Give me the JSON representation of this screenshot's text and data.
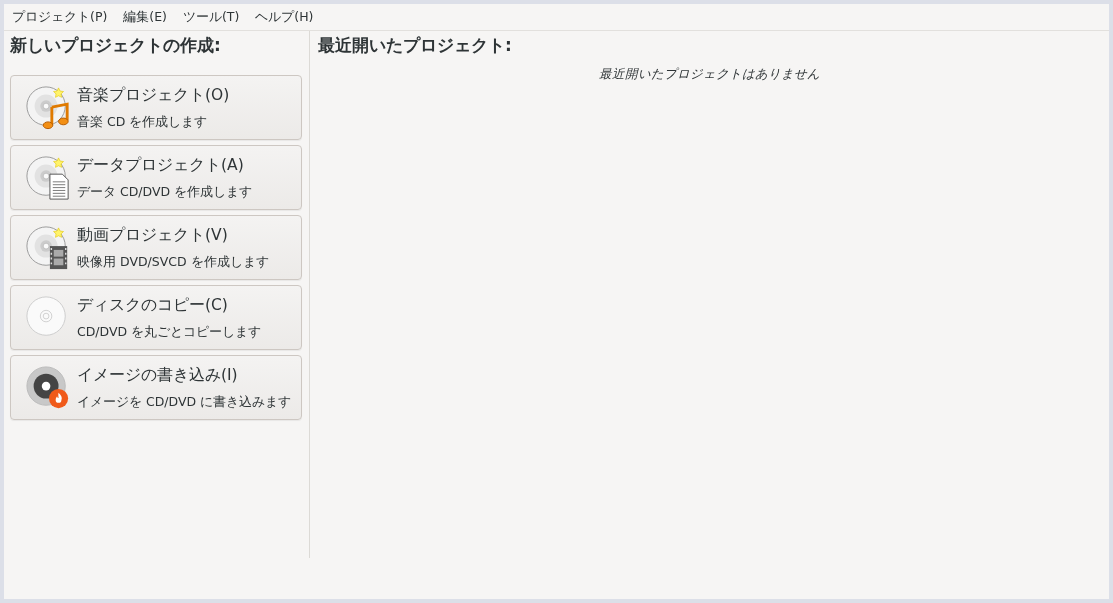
{
  "menu": [
    {
      "label": "プロジェクト(P)"
    },
    {
      "label": "編集(E)"
    },
    {
      "label": "ツール(T)"
    },
    {
      "label": "ヘルプ(H)"
    }
  ],
  "new_project": {
    "heading": "新しいプロジェクトの作成:",
    "buttons": [
      {
        "kind": "audio",
        "title": "音楽プロジェクト(O)",
        "description": "音楽 CD を作成します"
      },
      {
        "kind": "data",
        "title": "データプロジェクト(A)",
        "description": "データ CD/DVD を作成します"
      },
      {
        "kind": "video",
        "title": "動画プロジェクト(V)",
        "description": "映像用 DVD/SVCD を作成します"
      },
      {
        "kind": "copy",
        "title": "ディスクのコピー(C)",
        "description": "CD/DVD を丸ごとコピーします"
      },
      {
        "kind": "burn",
        "title": "イメージの書き込み(I)",
        "description": "イメージを CD/DVD に書き込みます"
      }
    ]
  },
  "recent": {
    "heading": "最近開いたプロジェクト:",
    "empty_message": "最近開いたプロジェクトはありません"
  }
}
